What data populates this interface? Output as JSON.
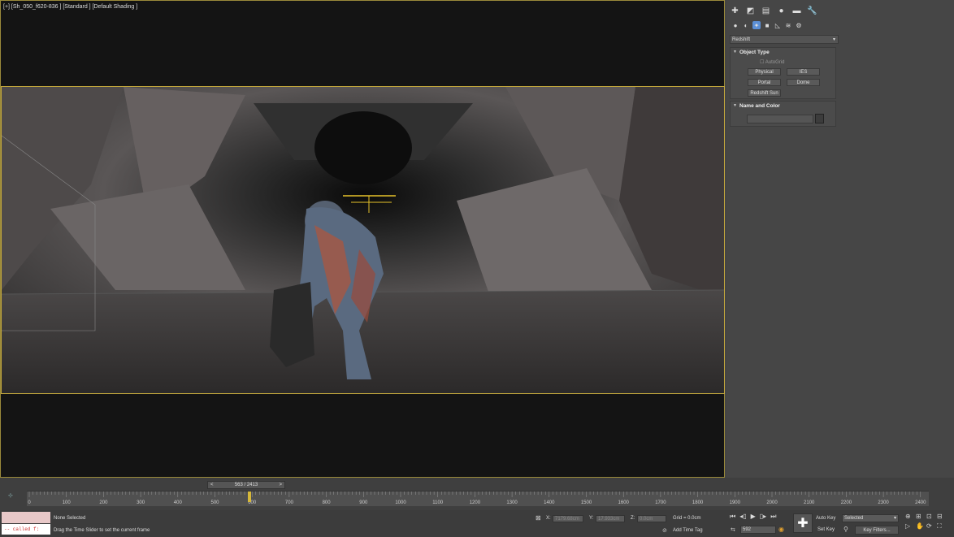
{
  "viewport": {
    "label": "[+] [Sh_050_f620-836 ] [Standard ] [Default Shading ]"
  },
  "command_panel": {
    "tabs": [
      "create-icon",
      "modify-icon",
      "hierarchy-icon",
      "motion-icon",
      "display-icon",
      "utilities-icon"
    ],
    "subtabs": [
      "geometry-icon",
      "shapes-icon",
      "lights-icon",
      "cameras-icon",
      "helpers-icon",
      "spacewarps-icon",
      "systems-icon"
    ],
    "renderer": "Redshift",
    "object_type": {
      "title": "Object Type",
      "autogrid": "AutoGrid",
      "buttons": [
        "Physical",
        "IES",
        "Portal",
        "Dome"
      ],
      "sun_button": "Redshift Sun"
    },
    "name_color": {
      "title": "Name and Color"
    }
  },
  "timeline": {
    "frame_display": "563 / 2413",
    "prev": "<",
    "next": ">",
    "ticks": [
      "0",
      "100",
      "200",
      "300",
      "400",
      "500",
      "600",
      "700",
      "800",
      "900",
      "1000",
      "1100",
      "1200",
      "1300",
      "1400",
      "1500",
      "1600",
      "1700",
      "1800",
      "1900",
      "2000",
      "2100",
      "2200",
      "2300",
      "2400"
    ]
  },
  "status": {
    "maxscript": "-- called f:",
    "selection": "None Selected",
    "prompt": "Drag the Time Slider to set the current frame",
    "x_label": "X:",
    "x_value": "7179.68cm",
    "y_label": "Y:",
    "y_value": "17.933cm",
    "z_label": "Z:",
    "z_value": "0.0cm",
    "grid": "Grid = 0.0cm",
    "add_time_tag": "Add Time Tag",
    "auto_key": "Auto Key",
    "set_key": "Set Key",
    "selected": "Selected",
    "key_filters": "Key Filters...",
    "current_frame": "592"
  },
  "colors": {
    "viewport_bg": "#141414",
    "safe_frame": "#c4a83c",
    "panel_bg": "#464646",
    "accent_blue": "#5b8fd6"
  }
}
